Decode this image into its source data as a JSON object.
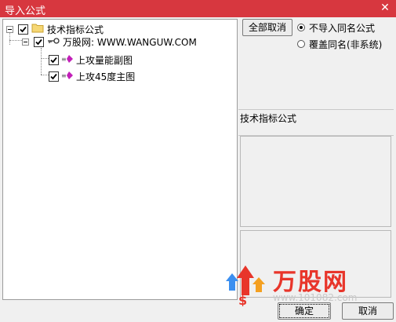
{
  "window": {
    "title": "导入公式",
    "close_glyph": "✕"
  },
  "tree": {
    "root": {
      "label": "技术指标公式",
      "checked": true,
      "expanded": true,
      "icon": "folder-icon"
    },
    "source": {
      "label": "万股网: WWW.WANGUW.COM",
      "checked": true,
      "expanded": true,
      "icon": "key-icon"
    },
    "items": [
      {
        "label": "上攻量能副图",
        "checked": true,
        "icon": "formula-icon"
      },
      {
        "label": "上攻45度主图",
        "checked": true,
        "icon": "formula-icon"
      }
    ]
  },
  "right": {
    "cancel_all_label": "全部取消",
    "options": [
      {
        "label": "不导入同名公式",
        "selected": true
      },
      {
        "label": "覆盖同名(非系统)",
        "selected": false
      }
    ],
    "info_label": "技术指标公式"
  },
  "footer": {
    "ok_label": "确定",
    "cancel_label": "取消"
  },
  "watermark": {
    "brand_text": "万股网",
    "url_text": "www.101082.com"
  },
  "colors": {
    "titlebar": "#d7373f",
    "brand_red": "#e8352a",
    "arrow_blue": "#3b8ff0",
    "arrow_orange": "#f4a020"
  }
}
